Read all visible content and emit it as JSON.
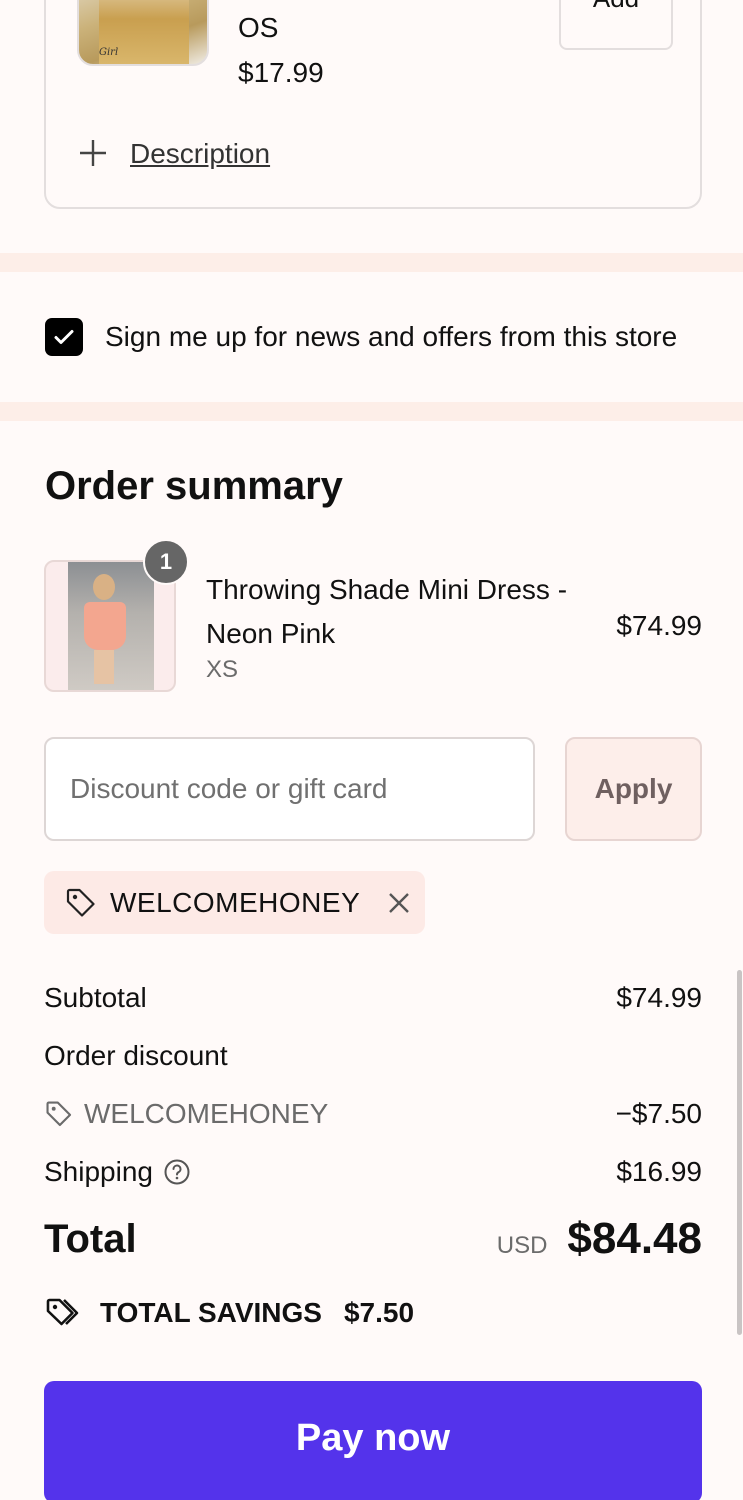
{
  "upsell": {
    "size": "OS",
    "price": "$17.99",
    "add_label": "Add",
    "description_link": "Description",
    "image_brand": "Girl"
  },
  "newsletter": {
    "label": "Sign me up for news and offers from this store",
    "checked": true
  },
  "order_summary": {
    "title": "Order summary",
    "item": {
      "quantity": "1",
      "name": "Throwing Shade Mini Dress - Neon Pink",
      "variant": "XS",
      "price": "$74.99"
    },
    "discount": {
      "placeholder": "Discount code or gift card",
      "apply_label": "Apply",
      "applied_code": "WELCOMEHONEY"
    },
    "lines": {
      "subtotal_label": "Subtotal",
      "subtotal_value": "$74.99",
      "order_discount_label": "Order discount",
      "discount_code": "WELCOMEHONEY",
      "discount_value": "−$7.50",
      "shipping_label": "Shipping",
      "shipping_value": "$16.99"
    },
    "total": {
      "label": "Total",
      "currency": "USD",
      "amount": "$84.48"
    },
    "savings": {
      "label": "TOTAL SAVINGS",
      "amount": "$7.50"
    }
  },
  "pay_button": {
    "label": "Pay now"
  },
  "colors": {
    "accent": "#5433eb",
    "background": "#fffaf9",
    "band": "#fdeee8",
    "chip": "#fdeae6"
  }
}
